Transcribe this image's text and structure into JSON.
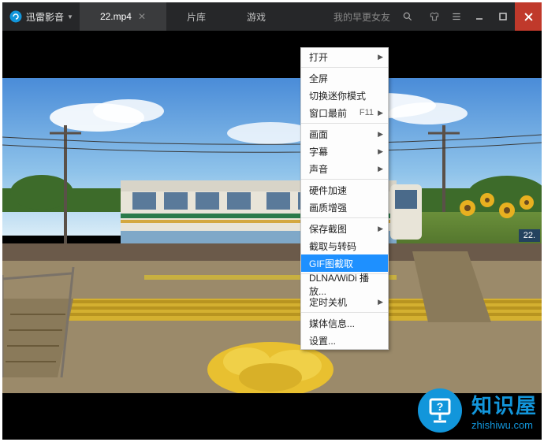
{
  "app": {
    "name": "迅雷影音"
  },
  "tabs": [
    {
      "label": "22.mp4",
      "active": true
    },
    {
      "label": "片库",
      "active": false
    },
    {
      "label": "游戏",
      "active": false
    }
  ],
  "search": {
    "placeholder": "我的早更女友"
  },
  "time_badge": "22.",
  "context_menu": {
    "items": [
      {
        "label": "打开",
        "submenu": true
      },
      {
        "sep": true
      },
      {
        "label": "全屏"
      },
      {
        "label": "切换迷你模式"
      },
      {
        "label": "窗口最前",
        "shortcut": "F11",
        "submenu": true
      },
      {
        "sep": true
      },
      {
        "label": "画面",
        "submenu": true
      },
      {
        "label": "字幕",
        "submenu": true
      },
      {
        "label": "声音",
        "submenu": true
      },
      {
        "sep": true
      },
      {
        "label": "硬件加速"
      },
      {
        "label": "画质增强"
      },
      {
        "sep": true
      },
      {
        "label": "保存截图",
        "submenu": true
      },
      {
        "label": "截取与转码"
      },
      {
        "label": "GIF图截取",
        "highlighted": true
      },
      {
        "sep": true
      },
      {
        "label": "DLNA/WiDi 播放..."
      },
      {
        "label": "定时关机",
        "submenu": true
      },
      {
        "sep": true
      },
      {
        "label": "媒体信息..."
      },
      {
        "label": "设置..."
      }
    ]
  },
  "watermark": {
    "title": "知识屋",
    "url": "zhishiwu.com"
  }
}
